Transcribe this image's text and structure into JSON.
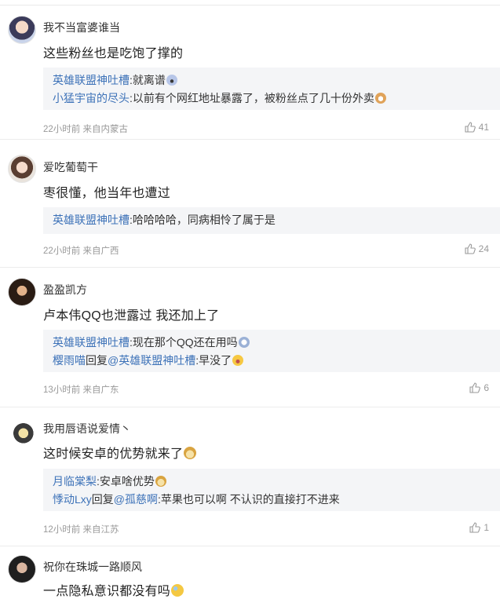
{
  "comments": [
    {
      "username": "我不当富婆谁当",
      "content": "这些粉丝也是吃饱了撑的",
      "replies": [
        {
          "author": "英雄联盟神吐槽",
          "sep": ":",
          "text": "就离谱",
          "emoji": "shocked-emoji-icon"
        },
        {
          "author": "小猛宇宙的尽头",
          "sep": ":",
          "text": "以前有个网红地址暴露了，被粉丝点了几十份外卖",
          "emoji": "cat-emoji-icon"
        }
      ],
      "time": "22小时前",
      "location": "来自内蒙古",
      "likes": "41"
    },
    {
      "username": "爱吃葡萄干",
      "content": "枣很懂，他当年也遭过",
      "replies": [
        {
          "author": "英雄联盟神吐槽",
          "sep": ":",
          "text": "哈哈哈哈，同病相怜了属于是"
        }
      ],
      "time": "22小时前",
      "location": "来自广西",
      "likes": "24"
    },
    {
      "username": "盈盈凯方",
      "content": "卢本伟QQ也泄露过 我还加上了",
      "replies": [
        {
          "author": "英雄联盟神吐槽",
          "sep": ":",
          "text": "现在那个QQ还在用吗",
          "emoji": "thinking-emoji-icon"
        },
        {
          "author": "樱雨喵",
          "mid": "回复",
          "target": "@英雄联盟神吐槽",
          "sep": ":",
          "text": "早没了",
          "emoji": "laughing-emoji-icon"
        }
      ],
      "time": "13小时前",
      "location": "来自广东",
      "likes": "6"
    },
    {
      "username": "我用唇语说爱情丶",
      "content": "这时候安卓的优势就来了",
      "content_emoji": "doge-emoji-icon",
      "replies": [
        {
          "author": "月临棠梨",
          "sep": ":",
          "text": "安卓啥优势",
          "emoji": "doge-emoji-icon"
        },
        {
          "author": "悸动Lxy",
          "mid": "回复",
          "target": "@孤慈啊",
          "sep": ":",
          "text": "苹果也可以啊 不认识的直接打不进来"
        }
      ],
      "time": "12小时前",
      "location": "来自江苏",
      "likes": "1"
    },
    {
      "username": "祝你在珠城一路顺风",
      "content": "一点隐私意识都没有吗",
      "content_emoji": "sweat-emoji-icon"
    }
  ],
  "colors": {
    "link": "#3d72b8",
    "reply_bg": "#f4f5f7",
    "meta": "#999999"
  }
}
